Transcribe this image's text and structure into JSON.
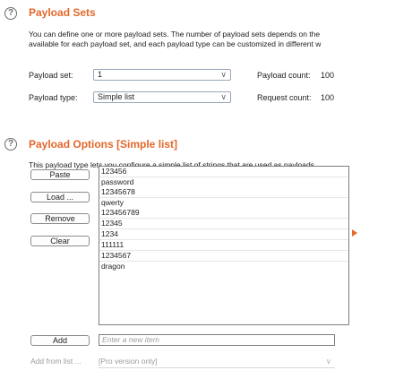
{
  "payload_sets": {
    "title": "Payload Sets",
    "desc_line1": "You can define one or more payload sets. The number of payload sets depends on the",
    "desc_line2": "available for each payload set, and each payload type can be customized in different w",
    "payload_set_label": "Payload set:",
    "payload_set_value": "1",
    "payload_type_label": "Payload type:",
    "payload_type_value": "Simple list",
    "payload_count_label": "Payload count:",
    "payload_count_value": "100",
    "request_count_label": "Request count:",
    "request_count_value": "100"
  },
  "payload_options": {
    "title": "Payload Options [Simple list]",
    "desc": "This payload type lets you configure a simple list of strings that are used as payloads.",
    "buttons": {
      "paste": "Paste",
      "load": "Load ...",
      "remove": "Remove",
      "clear": "Clear",
      "add": "Add"
    },
    "list_items": [
      "123456",
      "password",
      "12345678",
      "qwerty",
      "123456789",
      "12345",
      "1234",
      "111111",
      "1234567",
      "dragon"
    ],
    "add_placeholder": "Enter a new item",
    "add_from_list_label": "Add from list ...",
    "add_from_list_value": "[Pro version only]"
  },
  "colors": {
    "accent": "#e3682a",
    "border": "#7d7d7d",
    "disabled_text": "#9c9c9c"
  },
  "icons": {
    "help": "help-circle-icon",
    "dropdown": "chevron-down-icon",
    "expand": "triangle-right-icon"
  }
}
